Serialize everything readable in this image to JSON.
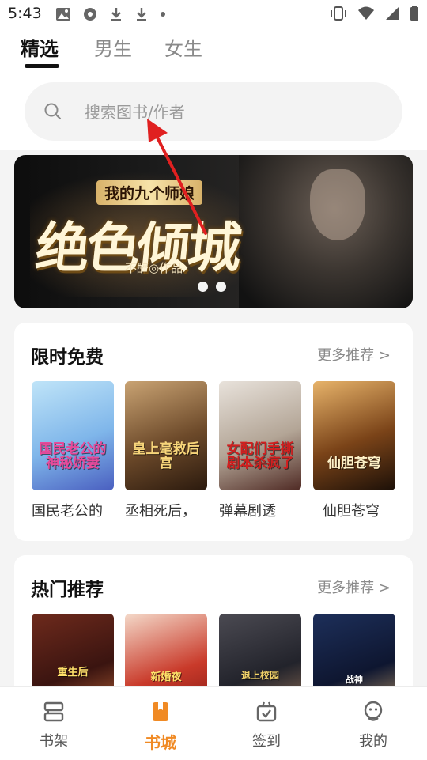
{
  "status_bar": {
    "time": "5:43"
  },
  "top_tabs": {
    "tabs": [
      "精选",
      "男生",
      "女生"
    ],
    "active": "精选"
  },
  "search": {
    "placeholder": "搜索图书/作者"
  },
  "banner": {
    "subtitle": "我的九个师娘",
    "title": "绝色倾城",
    "author": "不醉◎作品",
    "dots": 2
  },
  "sections": {
    "free": {
      "title": "限时免费",
      "more": "更多推荐 >",
      "books": [
        {
          "title": "国民老公的",
          "cover_text": "国民老公的神秘娇妻",
          "cover_colors": [
            "#bfe4f8",
            "#7fb6ea",
            "#4a5fc0"
          ],
          "text_color": "#e84a9a"
        },
        {
          "title": "丞相死后，",
          "cover_text": "皇上毫救后宫",
          "cover_colors": [
            "#c9a373",
            "#6d4a2a",
            "#2b1a0e"
          ],
          "text_color": "#f7d57a"
        },
        {
          "title": "弹幕剧透",
          "cover_text": "女配们手撕剧本杀疯了",
          "cover_colors": [
            "#e8e2db",
            "#b3a596",
            "#4f2a24"
          ],
          "text_color": "#d21f1f"
        },
        {
          "title": "仙胆苍穹",
          "cover_text": "仙胆苍穹",
          "cover_colors": [
            "#e7b36a",
            "#7a4318",
            "#1c1008"
          ],
          "text_color": "#fff2c8"
        }
      ]
    },
    "hot": {
      "title": "热门推荐",
      "more": "更多推荐 >",
      "books": [
        {
          "cover_text": "重生后",
          "cover_colors": [
            "#6e2a1c",
            "#3a1410",
            "#c56a3a"
          ],
          "text_color": "#ffe06a"
        },
        {
          "cover_text": "新婚夜",
          "cover_colors": [
            "#f4d9c9",
            "#c93a2a",
            "#7a1512"
          ],
          "text_color": "#ffe46a"
        },
        {
          "cover_text": "退上校园",
          "cover_colors": [
            "#4b4a52",
            "#22232b",
            "#a57d5f"
          ],
          "text_color": "#f3d46a"
        },
        {
          "cover_text": "战神",
          "cover_colors": [
            "#1d2f5a",
            "#0e1630",
            "#c9a36a"
          ],
          "text_color": "#ffffff"
        }
      ]
    }
  },
  "bottom_nav": {
    "items": [
      {
        "label": "书架",
        "icon": "bookshelf-icon"
      },
      {
        "label": "书城",
        "icon": "bookstore-icon"
      },
      {
        "label": "签到",
        "icon": "checkin-icon"
      },
      {
        "label": "我的",
        "icon": "profile-icon"
      }
    ],
    "active": "书城"
  },
  "colors": {
    "accent": "#f08a24",
    "annotation_arrow": "#e02020"
  }
}
